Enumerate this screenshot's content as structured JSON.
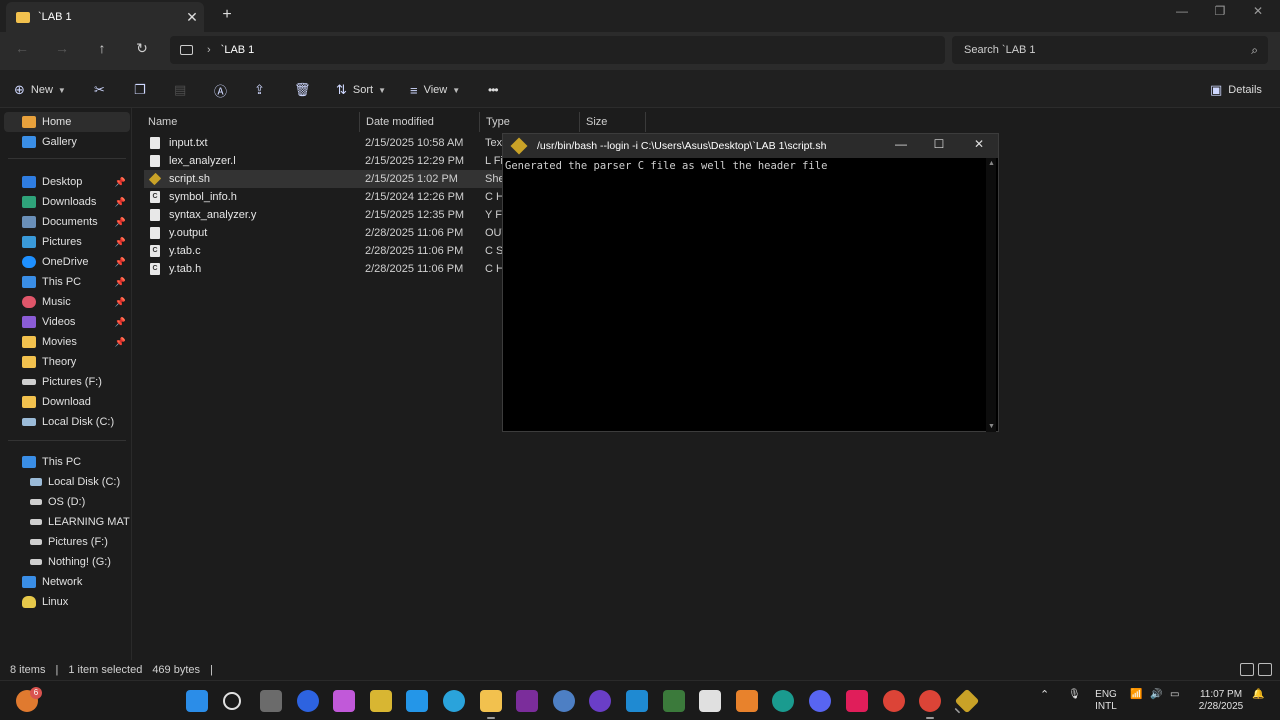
{
  "tab": {
    "title": "`LAB 1",
    "close": "✕",
    "new": "+"
  },
  "window_controls": {
    "minimize": "—",
    "maximize": "❐",
    "close": "✕"
  },
  "address": {
    "crumb": "`LAB 1",
    "search_placeholder": "Search `LAB 1"
  },
  "toolbar": {
    "new": "New",
    "sort": "Sort",
    "view": "View",
    "more": "•••",
    "details": "Details"
  },
  "sidebar": {
    "home": "Home",
    "gallery": "Gallery",
    "pinned": [
      "Desktop",
      "Downloads",
      "Documents",
      "Pictures",
      "OneDrive",
      "This PC",
      "Music",
      "Videos",
      "Movies"
    ],
    "folders": [
      "Theory",
      "Pictures (F:)",
      "Download",
      "Local Disk (C:)"
    ],
    "thispc": "This PC",
    "drives": [
      "Local Disk (C:)",
      "OS (D:)",
      "LEARNING MATERI...",
      "Pictures (F:)",
      "Nothing! (G:)"
    ],
    "network": "Network",
    "linux": "Linux"
  },
  "columns": {
    "name": "Name",
    "date": "Date modified",
    "type": "Type",
    "size": "Size"
  },
  "files": [
    {
      "name": "input.txt",
      "date": "2/15/2025 10:58 AM",
      "type": "Text",
      "icon": "doc"
    },
    {
      "name": "lex_analyzer.l",
      "date": "2/15/2025 12:29 PM",
      "type": "L Fil",
      "icon": "doc"
    },
    {
      "name": "script.sh",
      "date": "2/15/2025 1:02 PM",
      "type": "Shel",
      "icon": "git"
    },
    {
      "name": "symbol_info.h",
      "date": "2/15/2024 12:26 PM",
      "type": "C He",
      "icon": "c"
    },
    {
      "name": "syntax_analyzer.y",
      "date": "2/15/2025 12:35 PM",
      "type": "Y Fil",
      "icon": "doc"
    },
    {
      "name": "y.output",
      "date": "2/28/2025 11:06 PM",
      "type": "OUT",
      "icon": "doc"
    },
    {
      "name": "y.tab.c",
      "date": "2/28/2025 11:06 PM",
      "type": "C Sc",
      "icon": "c"
    },
    {
      "name": "y.tab.h",
      "date": "2/28/2025 11:06 PM",
      "type": "C He",
      "icon": "c"
    }
  ],
  "terminal": {
    "title": "/usr/bin/bash --login -i C:\\Users\\Asus\\Desktop\\`LAB 1\\script.sh",
    "output": "Generated the parser C file as well the header file"
  },
  "status": {
    "items": "8 items",
    "selected": "1 item selected",
    "size": "469 bytes",
    "sep": "|"
  },
  "taskbar": {
    "badge": "6",
    "lang1": "ENG",
    "lang2": "INTL",
    "time": "11:07 PM",
    "date": "2/28/2025"
  },
  "colors": {
    "accent": "#0078d4",
    "folder": "#f2c14e",
    "selected_row": "#333333"
  }
}
